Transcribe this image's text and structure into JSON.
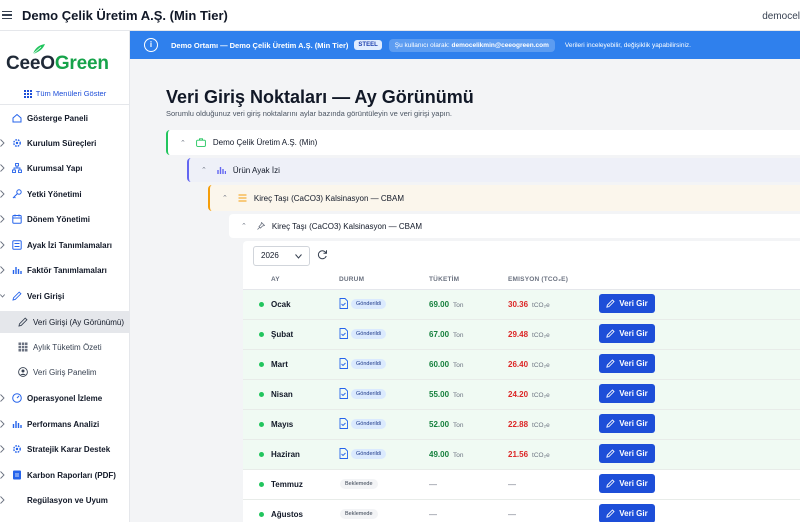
{
  "header": {
    "title": "Demo Çelik Üretim A.Ş. (Min Tier)",
    "user": "democel"
  },
  "logo": {
    "part1": "CeeO",
    "part2": "Green"
  },
  "sidebar": {
    "show_all": "Tüm Menüleri Göster",
    "items": [
      {
        "label": "Gösterge Paneli"
      },
      {
        "label": "Kurulum Süreçleri"
      },
      {
        "label": "Kurumsal Yapı"
      },
      {
        "label": "Yetki Yönetimi"
      },
      {
        "label": "Dönem Yönetimi"
      },
      {
        "label": "Ayak İzi Tanımlamaları"
      },
      {
        "label": "Faktör Tanımlamaları"
      },
      {
        "label": "Veri Girişi"
      },
      {
        "label": "Operasyonel İzleme"
      },
      {
        "label": "Performans Analizi"
      },
      {
        "label": "Stratejik Karar Destek"
      },
      {
        "label": "Karbon Raporları (PDF)"
      },
      {
        "label": "Regülasyon ve Uyum"
      }
    ],
    "sub_items": [
      {
        "label": "Veri Girişi (Ay Görünümü)"
      },
      {
        "label": "Aylık Tüketim Özeti"
      },
      {
        "label": "Veri Giriş Panelim"
      }
    ]
  },
  "banner": {
    "env": "Demo Ortamı —",
    "company": "Demo Çelik Üretim A.Ş. (Min Tier)",
    "tier": "STEEL",
    "user_prefix": "Şu kullanıcı olarak:",
    "user_email": "democelikmin@ceeogreen.com",
    "note": "Verileri inceleyebilir, değişiklik yapabilirsiniz."
  },
  "page": {
    "title": "Veri Giriş Noktaları — Ay Görünümü",
    "subtitle": "Sorumlu olduğunuz veri giriş noktalarını aylar bazında görüntüleyin ve veri girişi yapın."
  },
  "tree": {
    "company": "Demo Çelik Üretim A.Ş. (Min)",
    "footprint": "Ürün Ayak İzi",
    "category": "Kireç Taşı (CaCO3) Kalsinasyon — CBAM",
    "point": "Kireç Taşı (CaCO3) Kalsinasyon — CBAM"
  },
  "table": {
    "year": "2026",
    "columns": {
      "month": "AY",
      "status": "DURUM",
      "consumption": "TÜKETİM",
      "emission": "EMISYON (TCO₂E)"
    },
    "consumption_unit": "Ton",
    "emission_unit": "tCO₂e",
    "enter_label": "Veri Gir",
    "dash": "—",
    "rows": [
      {
        "month": "Ocak",
        "status": "Gönderildi",
        "consumption": "69.00",
        "emission": "30.36"
      },
      {
        "month": "Şubat",
        "status": "Gönderildi",
        "consumption": "67.00",
        "emission": "29.48"
      },
      {
        "month": "Mart",
        "status": "Gönderildi",
        "consumption": "60.00",
        "emission": "26.40"
      },
      {
        "month": "Nisan",
        "status": "Gönderildi",
        "consumption": "55.00",
        "emission": "24.20"
      },
      {
        "month": "Mayıs",
        "status": "Gönderildi",
        "consumption": "52.00",
        "emission": "22.88"
      },
      {
        "month": "Haziran",
        "status": "Gönderildi",
        "consumption": "49.00",
        "emission": "21.56"
      },
      {
        "month": "Temmuz",
        "status": "Beklemede"
      },
      {
        "month": "Ağustos",
        "status": "Beklemede"
      }
    ]
  },
  "colors": {
    "accent": "#2f80ed",
    "primary_button": "#1d4ed8",
    "green": "#22c55e",
    "red": "#dc2626"
  }
}
